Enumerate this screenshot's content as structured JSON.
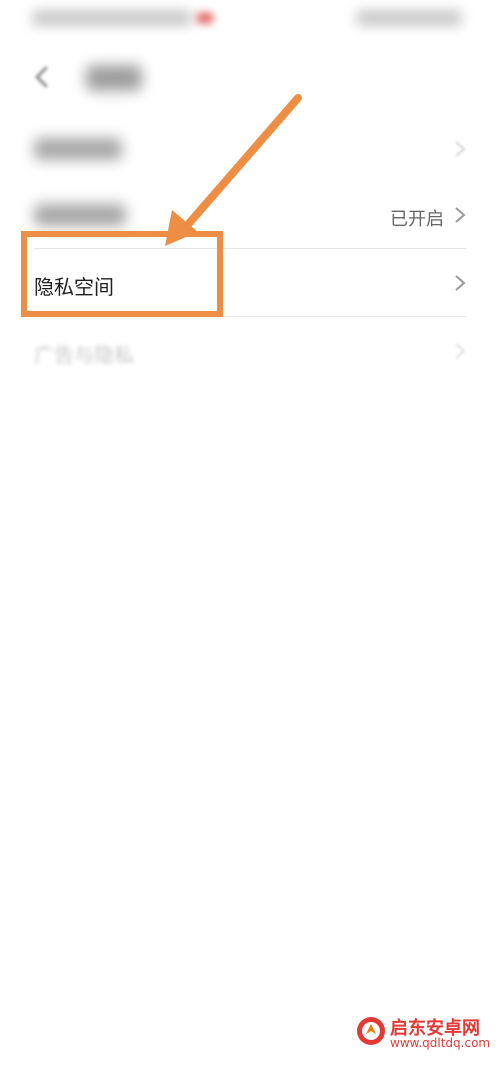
{
  "header": {
    "back_icon": "back-arrow-icon"
  },
  "settings": {
    "items": [
      {
        "label": "",
        "value": "",
        "blurred": true
      },
      {
        "label": "",
        "value": "已开启",
        "blurred": true
      },
      {
        "label": "隐私空间",
        "value": "",
        "blurred": false,
        "highlighted": true
      },
      {
        "label": "广告与隐私",
        "value": "",
        "blurred": true
      }
    ]
  },
  "annotation": {
    "color": "#EE8E44",
    "arrow_icon": "pointer-arrow-icon"
  },
  "watermark": {
    "title": "启东安卓网",
    "url": "www.qdltdq.com",
    "brand_color": "#E53935"
  }
}
